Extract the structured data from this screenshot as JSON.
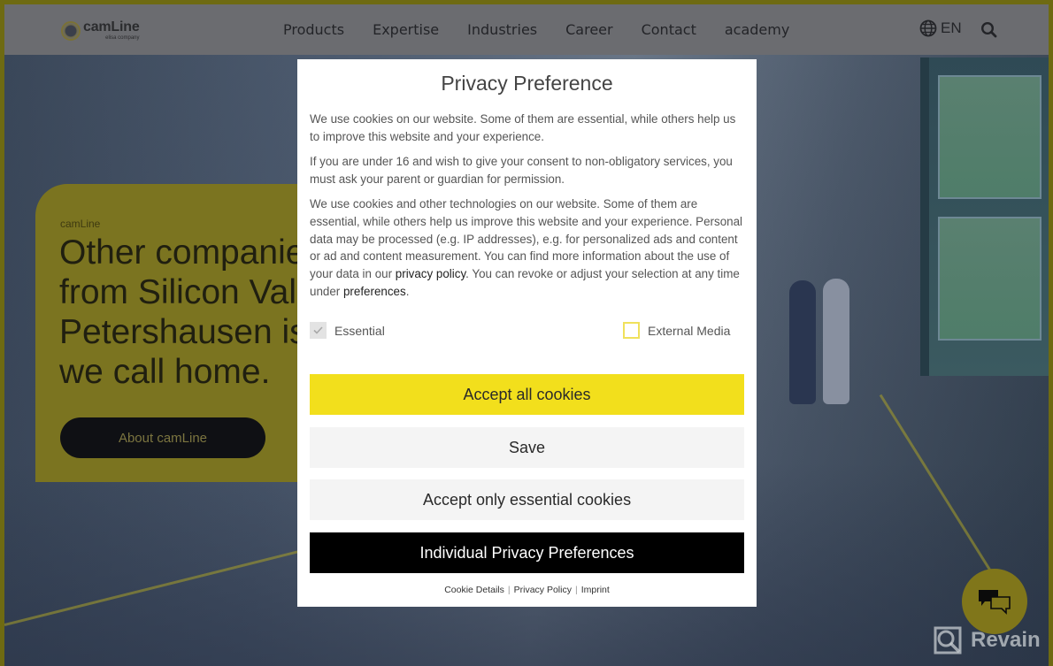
{
  "header": {
    "logo": {
      "name": "camLine",
      "subtitle": "elisa company"
    },
    "nav": [
      {
        "label": "Products"
      },
      {
        "label": "Expertise"
      },
      {
        "label": "Industries"
      },
      {
        "label": "Career"
      },
      {
        "label": "Contact"
      },
      {
        "label": "academy"
      }
    ],
    "language": {
      "icon": "globe-icon",
      "label": "EN"
    },
    "search": {
      "icon": "search-icon"
    }
  },
  "hero": {
    "tag": "camLine",
    "title_lines": [
      "Other companies",
      "from Silicon Valley",
      "Petershausen is w",
      "we call home."
    ],
    "button_label": "About camLine"
  },
  "modal": {
    "title": "Privacy Preference",
    "paragraph1": "We use cookies on our website. Some of them are essential, while others help us to improve this website and your experience.",
    "paragraph2": "If you are under 16 and wish to give your consent to non-obligatory services, you must ask your parent or guardian for permission.",
    "paragraph3": {
      "before_link1": "We use cookies and other technologies on our website. Some of them are essential, while others help us improve this website and your experience. Personal data may be processed (e.g. IP addresses), e.g. for personalized ads and content or ad and content measurement. You can find more information about the use of your data in our ",
      "link1": "privacy policy",
      "between_links": ". You can revoke or adjust your selection at any time under ",
      "link2": "preferences",
      "after_link2": "."
    },
    "checkboxes": [
      {
        "label": "Essential",
        "checked": true,
        "disabled": true
      },
      {
        "label": "External Media",
        "checked": false,
        "disabled": false
      }
    ],
    "buttons": {
      "accept_all": "Accept all cookies",
      "save": "Save",
      "accept_essential": "Accept only essential cookies",
      "individual": "Individual Privacy Preferences"
    },
    "footer_links": [
      "Cookie Details",
      "Privacy Policy",
      "Imprint"
    ],
    "footer_separator": "|"
  },
  "chat": {
    "icon": "chat-bubbles-icon"
  },
  "watermark": {
    "label": "Revain"
  },
  "colors": {
    "accent_yellow": "#f2df1c",
    "button_black": "#000000",
    "button_light": "#f4f4f4",
    "checkbox_border": "#f0e15c"
  }
}
